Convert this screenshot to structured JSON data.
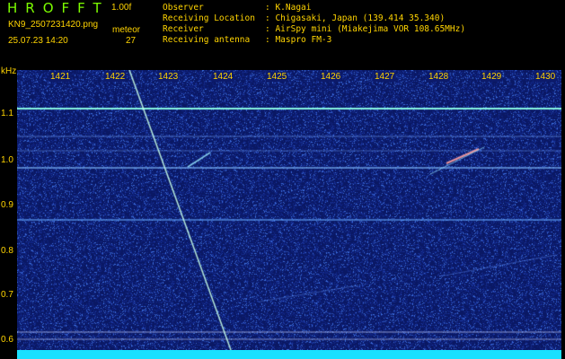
{
  "header": {
    "logo": "HROFFT",
    "version": "1.00f",
    "filename": "KN9_2507231420.png",
    "meteor_label": "meteor",
    "datetime": "25.07.23 14:20",
    "meteor_count": "27",
    "info": [
      {
        "label": "Observer",
        "value": ": K.Nagai"
      },
      {
        "label": "Receiving Location",
        "value": ": Chigasaki, Japan (139.414 35.340)"
      },
      {
        "label": "Receiver",
        "value": ": AirSpy mini (Miakejima VOR 108.65MHz)"
      },
      {
        "label": "Receiving antenna",
        "value": ": Maspro FM-3"
      }
    ]
  },
  "axes": {
    "y_unit": "kHz",
    "y_ticks": [
      "1.1",
      "1.0",
      "0.9",
      "0.8",
      "0.7",
      "0.6"
    ],
    "x_ticks": [
      "1421",
      "1422",
      "1423",
      "1424",
      "1425",
      "1426",
      "1427",
      "1428",
      "1429",
      "1430"
    ]
  },
  "colors": {
    "text": "#ffd400",
    "logo": "#7cfc00",
    "background": "#0c1a6b",
    "bottom_bar": "#19e0ff"
  }
}
